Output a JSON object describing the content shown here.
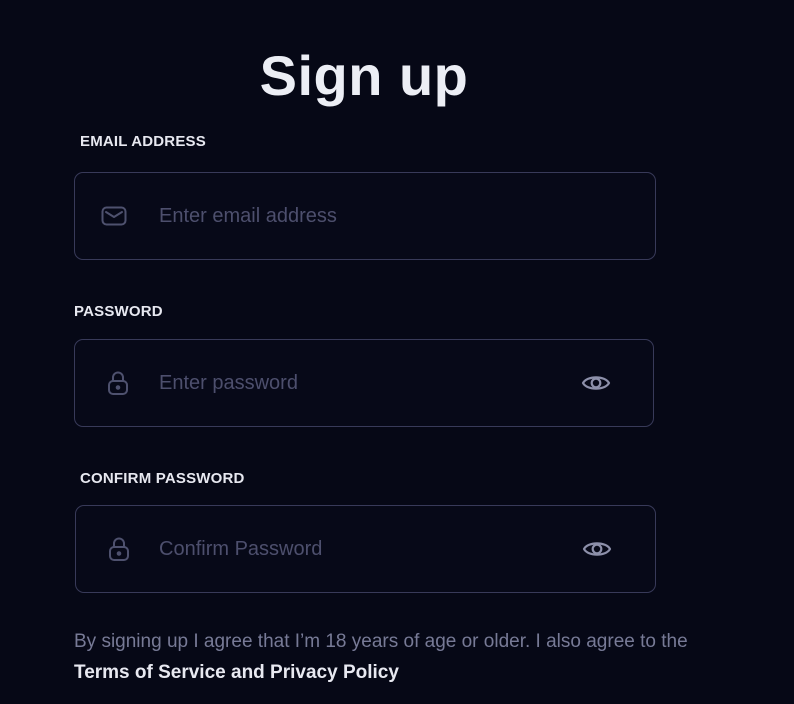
{
  "title": "Sign up",
  "email": {
    "label": "EMAIL ADDRESS",
    "placeholder": "Enter email address",
    "value": "",
    "icon": "mail-icon"
  },
  "password": {
    "label": "PASSWORD",
    "placeholder": "Enter password",
    "value": "",
    "icon": "lock-icon",
    "toggle_icon": "eye-icon"
  },
  "confirm_password": {
    "label": "CONFIRM PASSWORD",
    "placeholder": "Confirm Password",
    "value": "",
    "icon": "lock-icon",
    "toggle_icon": "eye-icon"
  },
  "legal": {
    "text": "By signing up I agree that I’m 18 years of age or older. I also agree to the ",
    "link": "Terms of Service and Privacy Policy"
  },
  "colors": {
    "background": "#060816",
    "field_border": "#383a59",
    "placeholder": "#4d4f6d",
    "label": "#e7e8f0",
    "muted_text": "#777a96"
  }
}
